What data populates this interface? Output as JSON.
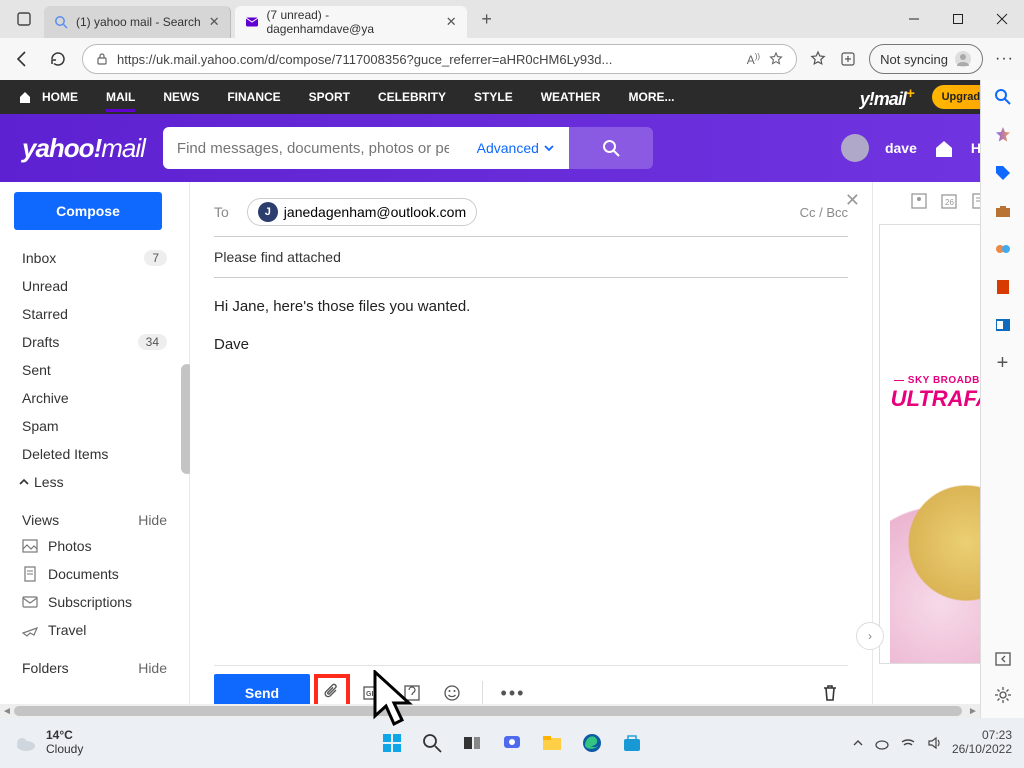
{
  "browser": {
    "tab1_label": "(1) yahoo mail - Search",
    "tab2_label": "(7 unread) - dagenhamdave@ya",
    "url": "https://uk.mail.yahoo.com/d/compose/7117008356?guce_referrer=aHR0cHM6Ly93d...",
    "sync_label": "Not syncing"
  },
  "ynav": {
    "home": "HOME",
    "mail": "MAIL",
    "news": "NEWS",
    "finance": "FINANCE",
    "sport": "SPORT",
    "celebrity": "CELEBRITY",
    "style": "STYLE",
    "weather": "WEATHER",
    "more": "MORE...",
    "brand": "y!mail",
    "upgrade": "Upgrade n"
  },
  "yheader": {
    "logo_a": "yahoo!",
    "logo_b": "mail",
    "search_placeholder": "Find messages, documents, photos or peo",
    "advanced": "Advanced",
    "user": "dave",
    "home": "Hom"
  },
  "sidebar": {
    "compose": "Compose",
    "folders": [
      {
        "label": "Inbox",
        "count": "7"
      },
      {
        "label": "Unread",
        "count": ""
      },
      {
        "label": "Starred",
        "count": ""
      },
      {
        "label": "Drafts",
        "count": "34"
      },
      {
        "label": "Sent",
        "count": ""
      },
      {
        "label": "Archive",
        "count": ""
      },
      {
        "label": "Spam",
        "count": ""
      },
      {
        "label": "Deleted Items",
        "count": ""
      }
    ],
    "less": "Less",
    "views_head": "Views",
    "hide": "Hide",
    "views": [
      "Photos",
      "Documents",
      "Subscriptions",
      "Travel"
    ],
    "folders_head": "Folders"
  },
  "compose": {
    "to_label": "To",
    "recipient": "janedagenham@outlook.com",
    "ccbcc": "Cc / Bcc",
    "subject": "Please find attached",
    "body_line1": "Hi Jane, here's those files you wanted.",
    "body_line2": "Dave",
    "send": "Send"
  },
  "ad": {
    "line1": "— SKY BROADBAND",
    "line2": "ULTRAFAS"
  },
  "taskbar": {
    "temp": "14°C",
    "cond": "Cloudy",
    "time": "07:23",
    "date": "26/10/2022"
  }
}
